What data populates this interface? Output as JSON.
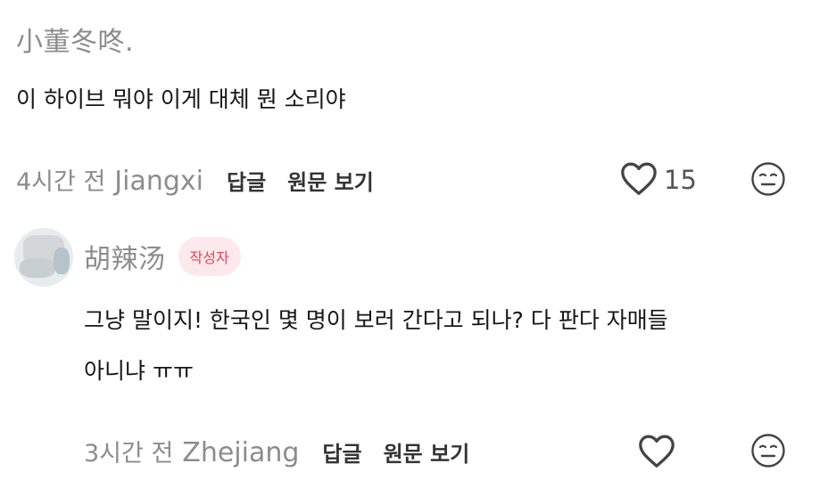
{
  "comment1": {
    "username": "小董冬咚.",
    "text": "이 하이브 뭐야 이게 대체 뭔 소리야",
    "time": "4시간 전",
    "location": "Jiangxi",
    "reply_label": "답글",
    "view_original_label": "원문 보기",
    "like_count": "15"
  },
  "reply1": {
    "username": "胡辣汤",
    "author_badge": "작성자",
    "text_line1": "그냥 말이지! 한국인 몇 명이 보러 간다고 되나? 다 판다 자매들",
    "text_line2": "아니냐 ㅠㅠ",
    "time": "3시간 전",
    "location": "Zhejiang",
    "reply_label": "답글",
    "view_original_label": "원문 보기"
  },
  "icons": {
    "like": "heart-outline-icon",
    "dislike": "meh-face-icon"
  }
}
